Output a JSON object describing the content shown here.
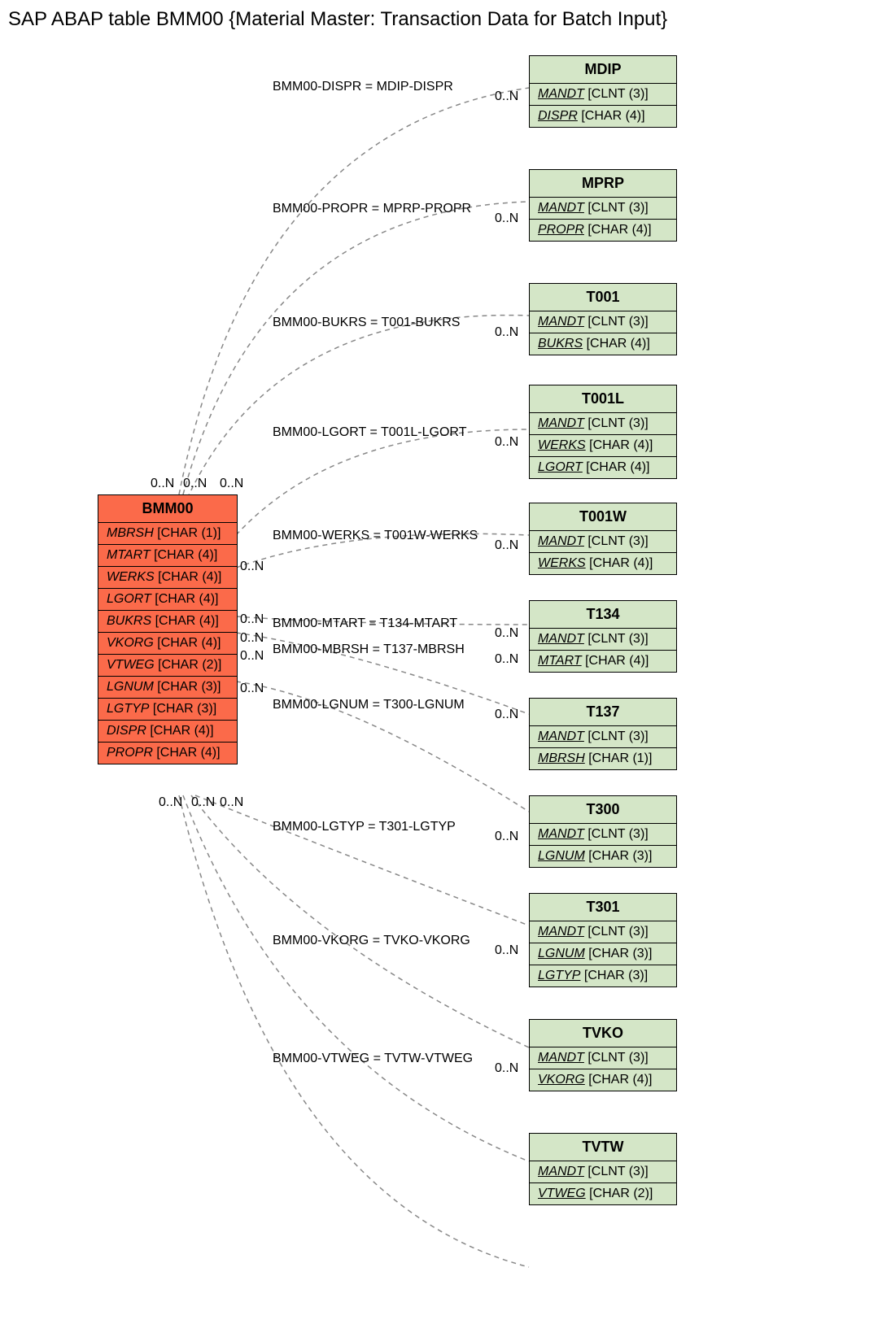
{
  "title": "SAP ABAP table BMM00 {Material Master: Transaction Data for Batch Input}",
  "main_entity": {
    "name": "BMM00",
    "fields": [
      {
        "name": "MBRSH",
        "type": "[CHAR (1)]"
      },
      {
        "name": "MTART",
        "type": "[CHAR (4)]"
      },
      {
        "name": "WERKS",
        "type": "[CHAR (4)]"
      },
      {
        "name": "LGORT",
        "type": "[CHAR (4)]"
      },
      {
        "name": "BUKRS",
        "type": "[CHAR (4)]"
      },
      {
        "name": "VKORG",
        "type": "[CHAR (4)]"
      },
      {
        "name": "VTWEG",
        "type": "[CHAR (2)]"
      },
      {
        "name": "LGNUM",
        "type": "[CHAR (3)]"
      },
      {
        "name": "LGTYP",
        "type": "[CHAR (3)]"
      },
      {
        "name": "DISPR",
        "type": "[CHAR (4)]"
      },
      {
        "name": "PROPR",
        "type": "[CHAR (4)]"
      }
    ]
  },
  "related_entities": [
    {
      "name": "MDIP",
      "fields": [
        {
          "name": "MANDT",
          "type": "[CLNT (3)]",
          "key": true
        },
        {
          "name": "DISPR",
          "type": "[CHAR (4)]",
          "key": true
        }
      ]
    },
    {
      "name": "MPRP",
      "fields": [
        {
          "name": "MANDT",
          "type": "[CLNT (3)]",
          "key": true
        },
        {
          "name": "PROPR",
          "type": "[CHAR (4)]",
          "key": true
        }
      ]
    },
    {
      "name": "T001",
      "fields": [
        {
          "name": "MANDT",
          "type": "[CLNT (3)]",
          "key": true
        },
        {
          "name": "BUKRS",
          "type": "[CHAR (4)]",
          "key": true
        }
      ]
    },
    {
      "name": "T001L",
      "fields": [
        {
          "name": "MANDT",
          "type": "[CLNT (3)]",
          "key": true
        },
        {
          "name": "WERKS",
          "type": "[CHAR (4)]",
          "key": true
        },
        {
          "name": "LGORT",
          "type": "[CHAR (4)]",
          "key": true
        }
      ]
    },
    {
      "name": "T001W",
      "fields": [
        {
          "name": "MANDT",
          "type": "[CLNT (3)]",
          "key": true
        },
        {
          "name": "WERKS",
          "type": "[CHAR (4)]",
          "key": true
        }
      ]
    },
    {
      "name": "T134",
      "fields": [
        {
          "name": "MANDT",
          "type": "[CLNT (3)]",
          "key": true
        },
        {
          "name": "MTART",
          "type": "[CHAR (4)]",
          "key": true
        }
      ]
    },
    {
      "name": "T137",
      "fields": [
        {
          "name": "MANDT",
          "type": "[CLNT (3)]",
          "key": true
        },
        {
          "name": "MBRSH",
          "type": "[CHAR (1)]",
          "key": true
        }
      ]
    },
    {
      "name": "T300",
      "fields": [
        {
          "name": "MANDT",
          "type": "[CLNT (3)]",
          "key": true
        },
        {
          "name": "LGNUM",
          "type": "[CHAR (3)]",
          "key": true
        }
      ]
    },
    {
      "name": "T301",
      "fields": [
        {
          "name": "MANDT",
          "type": "[CLNT (3)]",
          "key": true
        },
        {
          "name": "LGNUM",
          "type": "[CHAR (3)]",
          "key": true
        },
        {
          "name": "LGTYP",
          "type": "[CHAR (3)]",
          "key": true
        }
      ]
    },
    {
      "name": "TVKO",
      "fields": [
        {
          "name": "MANDT",
          "type": "[CLNT (3)]",
          "key": true
        },
        {
          "name": "VKORG",
          "type": "[CHAR (4)]",
          "key": true
        }
      ]
    },
    {
      "name": "TVTW",
      "fields": [
        {
          "name": "MANDT",
          "type": "[CLNT (3)]",
          "key": true
        },
        {
          "name": "VTWEG",
          "type": "[CHAR (2)]",
          "key": true
        }
      ]
    }
  ],
  "relations": [
    {
      "label": "BMM00-DISPR = MDIP-DISPR"
    },
    {
      "label": "BMM00-PROPR = MPRP-PROPR"
    },
    {
      "label": "BMM00-BUKRS = T001-BUKRS"
    },
    {
      "label": "BMM00-LGORT = T001L-LGORT"
    },
    {
      "label": "BMM00-WERKS = T001W-WERKS"
    },
    {
      "label": "BMM00-MTART = T134-MTART"
    },
    {
      "label": "BMM00-MBRSH = T137-MBRSH"
    },
    {
      "label": "BMM00-LGNUM = T300-LGNUM"
    },
    {
      "label": "BMM00-LGTYP = T301-LGTYP"
    },
    {
      "label": "BMM00-VKORG = TVKO-VKORG"
    },
    {
      "label": "BMM00-VTWEG = TVTW-VTWEG"
    }
  ],
  "cardinalities_left": [
    "0..N",
    "0..N",
    "0..N",
    "0..N",
    "0..N",
    "0..N",
    "0..N",
    "0..N",
    "0..N",
    "0..N",
    "0..N"
  ],
  "cardinalities_right": [
    "0..N",
    "0..N",
    "0..N",
    "0..N",
    "0..N",
    "0..N",
    "0..N",
    "0..N",
    "0..N",
    "0..N",
    "0..N"
  ]
}
